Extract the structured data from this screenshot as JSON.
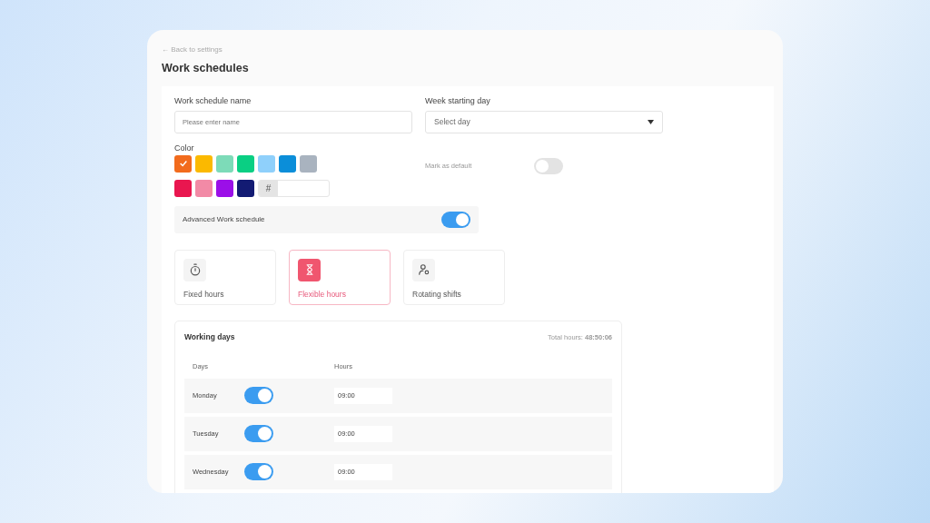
{
  "back_link": "← Back to settings",
  "title": "Work schedules",
  "name_field": {
    "label": "Work schedule name",
    "placeholder": "Please enter name"
  },
  "week_start": {
    "label": "Week starting day",
    "placeholder": "Select day"
  },
  "color": {
    "label": "Color",
    "hash": "#",
    "swatches": [
      {
        "color": "#f26b1d",
        "selected": true
      },
      {
        "color": "#fbb900",
        "selected": false
      },
      {
        "color": "#7ddbb8",
        "selected": false
      },
      {
        "color": "#0acf83",
        "selected": false
      },
      {
        "color": "#8fd0fb",
        "selected": false
      },
      {
        "color": "#0b8ed9",
        "selected": false
      },
      {
        "color": "#a9b3bf",
        "selected": false
      },
      {
        "color": "#e9164f",
        "selected": false
      },
      {
        "color": "#f28aa6",
        "selected": false
      },
      {
        "color": "#9b0fe8",
        "selected": false
      },
      {
        "color": "#131b73",
        "selected": false
      }
    ]
  },
  "mark_default": {
    "label": "Mark as default",
    "on": false
  },
  "advanced": {
    "label": "Advanced Work schedule",
    "on": true
  },
  "schedule_types": [
    {
      "kind": "stopwatch",
      "label": "Fixed hours",
      "selected": false
    },
    {
      "kind": "hourglass",
      "label": "Flexible hours",
      "selected": true
    },
    {
      "kind": "user",
      "label": "Rotating shifts",
      "selected": false
    }
  ],
  "working_days": {
    "title": "Working days",
    "total": "Total hours: **48:50:06**",
    "columns": [
      "Days",
      "Hours"
    ],
    "rows": [
      {
        "day": "Monday",
        "on": true,
        "hours": "09:00"
      },
      {
        "day": "Tuesday",
        "on": true,
        "hours": "09:00"
      },
      {
        "day": "Wednesday",
        "on": true,
        "hours": "09:00"
      }
    ]
  }
}
